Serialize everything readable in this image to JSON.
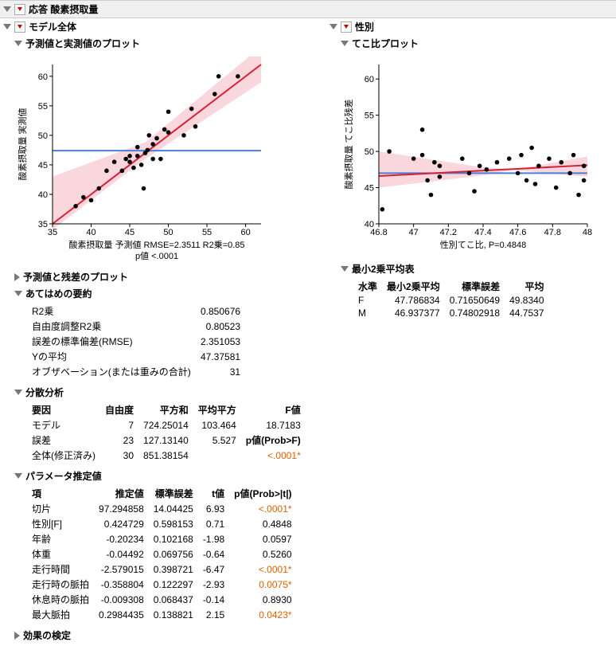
{
  "title": "応答 酸素摂取量",
  "left": {
    "modelTitle": "モデル全体",
    "plot1Title": "予測値と実測値のプロット",
    "plot1XLabel": "酸素摂取量 予測値 RMSE=2.3511 R2乗=0.85",
    "plot1PLabel": "p値 <.0001",
    "plot1YLabel": "酸素摂取量 実測値",
    "plot2Title": "予測値と残差のプロット",
    "fitTitle": "あてはめの要約",
    "fitRows": [
      [
        "R2乗",
        "0.850676"
      ],
      [
        "自由度調整R2乗",
        "0.80523"
      ],
      [
        "誤差の標準偏差(RMSE)",
        "2.351053"
      ],
      [
        "Yの平均",
        "47.37581"
      ],
      [
        "オブザベーション(または重みの合計)",
        "31"
      ]
    ],
    "anovaTitle": "分散分析",
    "anovaHead": [
      "要因",
      "自由度",
      "平方和",
      "平均平方",
      "F値"
    ],
    "anovaRows": [
      [
        "モデル",
        "7",
        "724.25014",
        "103.464",
        "18.7183"
      ],
      [
        "誤差",
        "23",
        "127.13140",
        "5.527",
        "p値(Prob>F)"
      ],
      [
        "全体(修正済み)",
        "30",
        "851.38154",
        "",
        "<.0001*"
      ]
    ],
    "paramTitle": "パラメータ推定値",
    "paramHead": [
      "項",
      "推定値",
      "標準誤差",
      "t値",
      "p値(Prob>|t|)"
    ],
    "paramRows": [
      [
        "切片",
        "97.294858",
        "14.04425",
        "6.93",
        "<.0001*",
        true
      ],
      [
        "性別[F]",
        "0.424729",
        "0.598153",
        "0.71",
        "0.4848",
        false
      ],
      [
        "年齢",
        "-0.20234",
        "0.102168",
        "-1.98",
        "0.0597",
        false
      ],
      [
        "体重",
        "-0.04492",
        "0.069756",
        "-0.64",
        "0.5260",
        false
      ],
      [
        "走行時間",
        "-2.579015",
        "0.398721",
        "-6.47",
        "<.0001*",
        true
      ],
      [
        "走行時の脈拍",
        "-0.358804",
        "0.122297",
        "-2.93",
        "0.0075*",
        true
      ],
      [
        "休息時の脈拍",
        "-0.009308",
        "0.068437",
        "-0.14",
        "0.8930",
        false
      ],
      [
        "最大脈拍",
        "0.2984435",
        "0.138821",
        "2.15",
        "0.0423*",
        true
      ]
    ],
    "effectTitle": "効果の検定"
  },
  "right": {
    "sexTitle": "性別",
    "levPlotTitle": "てこ比プロット",
    "levXLabel": "性別てこ比, P=0.4848",
    "levYLabel": "酸素摂取量 てこ比残差",
    "lsTitle": "最小2乗平均表",
    "lsHead": [
      "水準",
      "最小2乗平均",
      "標準誤差",
      "平均"
    ],
    "lsRows": [
      [
        "F",
        "47.786834",
        "0.71650649",
        "49.8340"
      ],
      [
        "M",
        "46.937377",
        "0.74802918",
        "44.7537"
      ]
    ]
  },
  "chart_data": [
    {
      "type": "scatter",
      "title": "予測値と実測値のプロット",
      "xlabel": "酸素摂取量 予測値",
      "ylabel": "酸素摂取量 実測値",
      "xlim": [
        35,
        62
      ],
      "ylim": [
        35,
        62
      ],
      "mean_line_y": 47.4,
      "fit_line": {
        "slope": 1,
        "intercept": 0
      },
      "points": [
        [
          38,
          38
        ],
        [
          39,
          39.5
        ],
        [
          40,
          39
        ],
        [
          41,
          41
        ],
        [
          42,
          44
        ],
        [
          43,
          45.5
        ],
        [
          44,
          44
        ],
        [
          44.5,
          46
        ],
        [
          45,
          45.5
        ],
        [
          45,
          46.5
        ],
        [
          45.5,
          44.5
        ],
        [
          46,
          46.5
        ],
        [
          46,
          48
        ],
        [
          46.5,
          45
        ],
        [
          46.8,
          41
        ],
        [
          47,
          47
        ],
        [
          47.3,
          47.5
        ],
        [
          47.5,
          50
        ],
        [
          48,
          46
        ],
        [
          48,
          48.5
        ],
        [
          48.5,
          49.5
        ],
        [
          49,
          46
        ],
        [
          49.5,
          51
        ],
        [
          50,
          50.5
        ],
        [
          50,
          54
        ],
        [
          52,
          50
        ],
        [
          53,
          54.5
        ],
        [
          53.5,
          51.5
        ],
        [
          56,
          57
        ],
        [
          56.5,
          60
        ],
        [
          59,
          60
        ]
      ]
    },
    {
      "type": "scatter",
      "title": "てこ比プロット",
      "xlabel": "性別てこ比",
      "ylabel": "酸素摂取量 てこ比残差",
      "xlim": [
        46.8,
        48.0
      ],
      "ylim": [
        40,
        62
      ],
      "mean_line_y": 47.0,
      "fit_slope_small": true,
      "points": [
        [
          46.82,
          42
        ],
        [
          46.86,
          50
        ],
        [
          47.0,
          49
        ],
        [
          47.05,
          49.5
        ],
        [
          47.05,
          53
        ],
        [
          47.08,
          46
        ],
        [
          47.1,
          44
        ],
        [
          47.12,
          48.5
        ],
        [
          47.15,
          48
        ],
        [
          47.15,
          46.5
        ],
        [
          47.28,
          49
        ],
        [
          47.32,
          47
        ],
        [
          47.35,
          44.5
        ],
        [
          47.38,
          48
        ],
        [
          47.42,
          47.5
        ],
        [
          47.48,
          48.5
        ],
        [
          47.55,
          49
        ],
        [
          47.6,
          47
        ],
        [
          47.62,
          49.5
        ],
        [
          47.65,
          46
        ],
        [
          47.68,
          50.5
        ],
        [
          47.7,
          45.5
        ],
        [
          47.72,
          48
        ],
        [
          47.78,
          49
        ],
        [
          47.82,
          45
        ],
        [
          47.85,
          48.5
        ],
        [
          47.9,
          47
        ],
        [
          47.92,
          49.5
        ],
        [
          47.95,
          44
        ],
        [
          47.98,
          48
        ],
        [
          47.98,
          46
        ]
      ]
    }
  ]
}
